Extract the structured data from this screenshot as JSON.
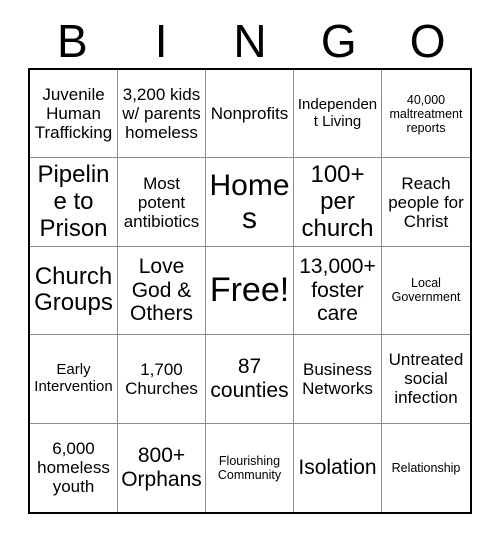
{
  "header": {
    "letters": [
      "B",
      "I",
      "N",
      "G",
      "O"
    ]
  },
  "grid": {
    "rows": [
      [
        {
          "text": "Juvenile Human Trafficking",
          "size": "fs-md"
        },
        {
          "text": "3,200 kids w/ parents homeless",
          "size": "fs-md"
        },
        {
          "text": "Nonprofits",
          "size": "fs-md"
        },
        {
          "text": "Independent Living",
          "size": "fs-sm"
        },
        {
          "text": "40,000 maltreatment reports",
          "size": "fs-xs"
        }
      ],
      [
        {
          "text": "Pipeline to Prison",
          "size": "fs-xl"
        },
        {
          "text": "Most potent antibiotics",
          "size": "fs-md"
        },
        {
          "text": "Homes",
          "size": "fs-xxl"
        },
        {
          "text": "100+ per church",
          "size": "fs-xl"
        },
        {
          "text": "Reach people for Christ",
          "size": "fs-md"
        }
      ],
      [
        {
          "text": "Church Groups",
          "size": "fs-xl"
        },
        {
          "text": "Love God & Others",
          "size": "fs-lg"
        },
        {
          "text": "Free!",
          "size": "fs-free"
        },
        {
          "text": "13,000+ foster care",
          "size": "fs-lg"
        },
        {
          "text": "Local Government",
          "size": "fs-xs"
        }
      ],
      [
        {
          "text": "Early Intervention",
          "size": "fs-sm"
        },
        {
          "text": "1,700 Churches",
          "size": "fs-md"
        },
        {
          "text": "87 counties",
          "size": "fs-lg"
        },
        {
          "text": "Business Networks",
          "size": "fs-md"
        },
        {
          "text": "Untreated social infection",
          "size": "fs-md"
        }
      ],
      [
        {
          "text": "6,000 homeless youth",
          "size": "fs-md"
        },
        {
          "text": "800+ Orphans",
          "size": "fs-lg"
        },
        {
          "text": "Flourishing Community",
          "size": "fs-xs"
        },
        {
          "text": "Isolation",
          "size": "fs-lg"
        },
        {
          "text": "Relationship",
          "size": "fs-xs"
        }
      ]
    ]
  },
  "colors": {
    "background": "#ffffff",
    "text": "#000000",
    "outer_border": "#000000",
    "inner_border": "#8c8c8c"
  }
}
